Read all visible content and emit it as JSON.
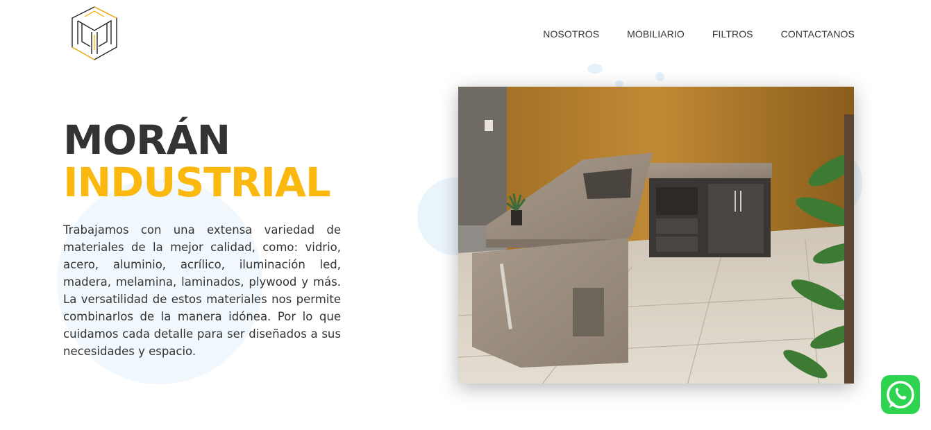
{
  "brand": {
    "logo_icon": "moran-industrial-logo",
    "accent_color": "#fbb80f",
    "dark_color": "#333333"
  },
  "nav": {
    "items": [
      {
        "label": "NOSOTROS"
      },
      {
        "label": "MOBILIARIO"
      },
      {
        "label": "FILTROS"
      },
      {
        "label": "CONTACTANOS"
      }
    ]
  },
  "hero": {
    "title_line1": "MORÁN",
    "title_line2": "INDUSTRIAL",
    "description": "Trabajamos con una extensa variedad de materiales de la mejor calidad, como: vidrio, acero, aluminio, acrílico, iluminación led, madera, melamina, laminados, plywood y más. La versatilidad de estos materiales nos permite combinarlos de la manera idónea. Por lo que cuidamos cada detalle para ser diseñados a sus necesidades y espacio.",
    "image_icon": "office-desk-photo"
  },
  "whatsapp": {
    "icon": "whatsapp-icon",
    "color": "#2ed34f"
  }
}
